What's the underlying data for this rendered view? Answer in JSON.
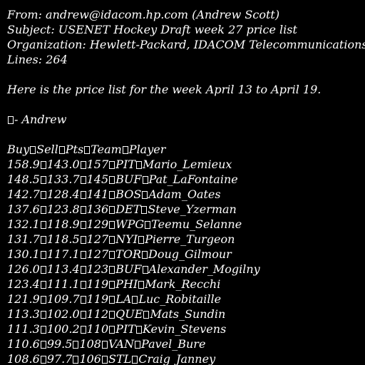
{
  "header": {
    "from": "From: andrew@idacom.hp.com (Andrew Scott)",
    "subject": "Subject: USENET Hockey Draft week 27 price list",
    "organization": "Organization: Hewlett-Packard, IDACOM Telecommunications Division",
    "lines": "Lines: 264"
  },
  "body": {
    "intro": "Here is the price list for the week April 13 to April 19.",
    "signature": "- Andrew"
  },
  "table": {
    "columns": [
      "Buy",
      "Sell",
      "Pts",
      "Team",
      "Player"
    ],
    "rows": [
      [
        "158.9",
        "143.0",
        "157",
        "PIT",
        "Mario_Lemieux"
      ],
      [
        "148.5",
        "133.7",
        "145",
        "BUF",
        "Pat_LaFontaine"
      ],
      [
        "142.7",
        "128.4",
        "141",
        "BOS",
        "Adam_Oates"
      ],
      [
        "137.6",
        "123.8",
        "136",
        "DET",
        "Steve_Yzerman"
      ],
      [
        "132.1",
        "118.9",
        "129",
        "WPG",
        "Teemu_Selanne"
      ],
      [
        "131.7",
        "118.5",
        "127",
        "NYI",
        "Pierre_Turgeon"
      ],
      [
        "130.1",
        "117.1",
        "127",
        "TOR",
        "Doug_Gilmour"
      ],
      [
        "126.0",
        "113.4",
        "123",
        "BUF",
        "Alexander_Mogilny"
      ],
      [
        "123.4",
        "111.1",
        "119",
        "PHI",
        "Mark_Recchi"
      ],
      [
        "121.9",
        "109.7",
        "119",
        "LA",
        "Luc_Robitaille"
      ],
      [
        "113.3",
        "102.0",
        "112",
        "QUE",
        "Mats_Sundin"
      ],
      [
        "111.3",
        "100.2",
        "110",
        "PIT",
        "Kevin_Stevens"
      ],
      [
        "110.6",
        "99.5",
        "108",
        "VAN",
        "Pavel_Bure"
      ],
      [
        "108.6",
        "97.7",
        "106",
        "STL",
        "Craig_Janney"
      ]
    ]
  }
}
